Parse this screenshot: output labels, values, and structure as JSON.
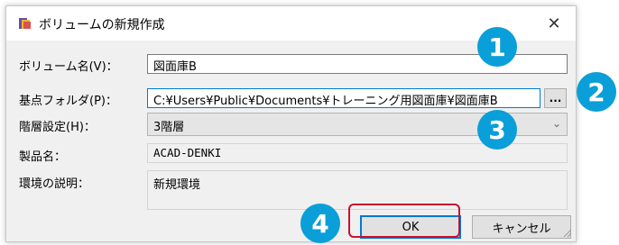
{
  "window": {
    "title": "ボリュームの新規作成",
    "close_glyph": "✕"
  },
  "form": {
    "volume_name": {
      "label": "ボリューム名(V)：",
      "value": "図面庫B"
    },
    "base_folder": {
      "label": "基点フォルダ(P)：",
      "value": "C:¥Users¥Public¥Documents¥トレーニング用図面庫¥図面庫B",
      "browse_label": "..."
    },
    "hierarchy": {
      "label": "階層設定(H)：",
      "value": "3階層"
    },
    "product_name": {
      "label": "製品名：",
      "value": "ACAD-DENKI"
    },
    "env_description": {
      "label": "環境の説明：",
      "value": "新規環境"
    }
  },
  "buttons": {
    "ok": "OK",
    "cancel": "キャンセル"
  },
  "badges": [
    "1",
    "2",
    "3",
    "4"
  ],
  "colors": {
    "badge": "#0a9fd8",
    "highlight": "#c8102e",
    "focus": "#0078d7"
  }
}
